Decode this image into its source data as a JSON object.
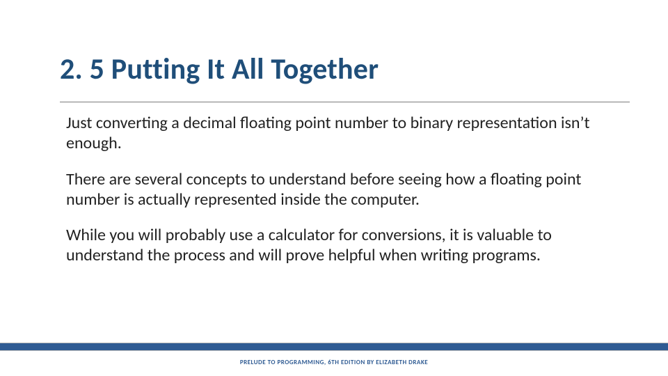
{
  "slide": {
    "title": "2. 5 Putting It All Together",
    "paragraphs": [
      "Just converting a decimal floating point number to binary representation isn’t enough.",
      "There are several concepts to understand before seeing how a floating point number is actually represented inside the computer.",
      "While you will probably use a calculator for conversions, it is valuable to understand the process and will prove helpful when writing programs."
    ],
    "footer": "PRELUDE TO PROGRAMMING, 6TH EDITION BY ELIZABETH DRAKE"
  }
}
